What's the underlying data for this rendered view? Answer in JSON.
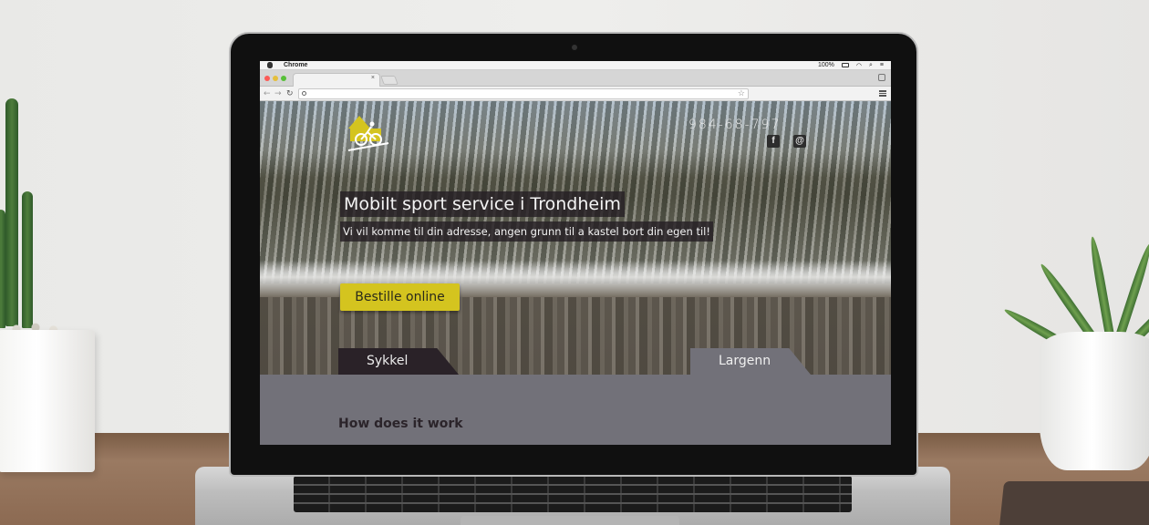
{
  "browser": {
    "app_name": "Chrome",
    "battery": "100%",
    "tab_close": "×"
  },
  "site": {
    "phone": "984-68-797",
    "social": {
      "facebook_glyph": "f",
      "email_glyph": "@"
    },
    "hero": {
      "title": "Mobilt sport service i Trondheim",
      "subtitle": "Vi vil komme til din adresse, angen grunn til a kastel bort din egen til!",
      "cta_label": "Bestille  online"
    },
    "tabs": [
      {
        "label": "Sykkel"
      },
      {
        "label": "Largenn"
      }
    ],
    "section_title": "How does it work"
  },
  "colors": {
    "accent": "#d4c41f",
    "dark_panel": "#2a2228",
    "section_bg": "#727179"
  },
  "icons": [
    "apple-icon",
    "battery-icon",
    "wifi-icon",
    "search-icon",
    "menu-icon",
    "star-icon",
    "facebook-icon",
    "email-icon",
    "cyclist-logo-icon"
  ]
}
